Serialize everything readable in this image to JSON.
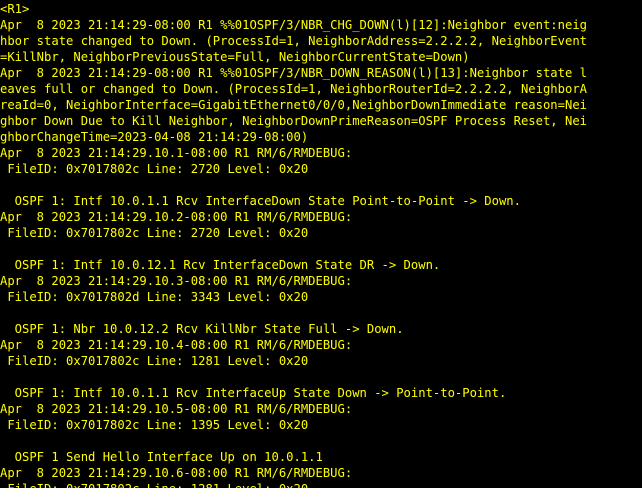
{
  "terminal": {
    "text_color": "#ffff00",
    "background_color": "#000000",
    "lines": [
      "<R1>",
      "Apr  8 2023 21:14:29-08:00 R1 %%01OSPF/3/NBR_CHG_DOWN(l)[12]:Neighbor event:neig",
      "hbor state changed to Down. (ProcessId=1, NeighborAddress=2.2.2.2, NeighborEvent",
      "=KillNbr, NeighborPreviousState=Full, NeighborCurrentState=Down)",
      "Apr  8 2023 21:14:29-08:00 R1 %%01OSPF/3/NBR_DOWN_REASON(l)[13]:Neighbor state l",
      "eaves full or changed to Down. (ProcessId=1, NeighborRouterId=2.2.2.2, NeighborA",
      "reaId=0, NeighborInterface=GigabitEthernet0/0/0,NeighborDownImmediate reason=Nei",
      "ghbor Down Due to Kill Neighbor, NeighborDownPrimeReason=OSPF Process Reset, Nei",
      "ghborChangeTime=2023-04-08 21:14:29-08:00)",
      "Apr  8 2023 21:14:29.10.1-08:00 R1 RM/6/RMDEBUG:",
      " FileID: 0x7017802c Line: 2720 Level: 0x20",
      "",
      "  OSPF 1: Intf 10.0.1.1 Rcv InterfaceDown State Point-to-Point -> Down.",
      "Apr  8 2023 21:14:29.10.2-08:00 R1 RM/6/RMDEBUG:",
      " FileID: 0x7017802c Line: 2720 Level: 0x20",
      "",
      "  OSPF 1: Intf 10.0.12.1 Rcv InterfaceDown State DR -> Down.",
      "Apr  8 2023 21:14:29.10.3-08:00 R1 RM/6/RMDEBUG:",
      " FileID: 0x7017802d Line: 3343 Level: 0x20",
      "",
      "  OSPF 1: Nbr 10.0.12.2 Rcv KillNbr State Full -> Down.",
      "Apr  8 2023 21:14:29.10.4-08:00 R1 RM/6/RMDEBUG:",
      " FileID: 0x7017802c Line: 1281 Level: 0x20",
      "",
      "  OSPF 1: Intf 10.0.1.1 Rcv InterfaceUp State Down -> Point-to-Point.",
      "Apr  8 2023 21:14:29.10.5-08:00 R1 RM/6/RMDEBUG:",
      " FileID: 0x7017802c Line: 1395 Level: 0x20",
      "",
      "  OSPF 1 Send Hello Interface Up on 10.0.1.1",
      "Apr  8 2023 21:14:29.10.6-08:00 R1 RM/6/RMDEBUG:",
      " FileID: 0x7017802c Line: 1281 Level: 0x20"
    ]
  }
}
